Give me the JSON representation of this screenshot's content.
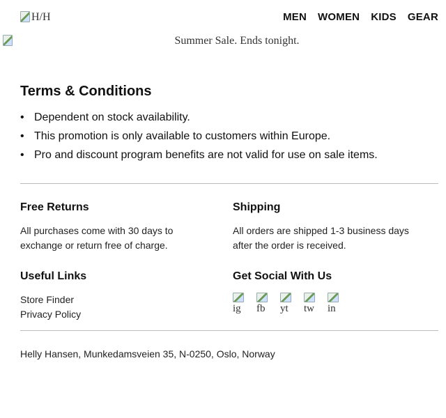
{
  "header": {
    "logo_alt": "H/H",
    "nav": [
      "MEN",
      "WOMEN",
      "KIDS",
      "GEAR"
    ]
  },
  "banner": {
    "text": "Summer Sale. Ends tonight."
  },
  "terms": {
    "title": "Terms & Conditions",
    "items": [
      "Dependent on stock availability.",
      "This promotion is only available to customers within Europe.",
      "Pro and discount program benefits are not valid for use on sale items."
    ]
  },
  "free_returns": {
    "title": "Free Returns",
    "text": "All purchases come with 30 days to exchange or return free of charge."
  },
  "shipping": {
    "title": "Shipping",
    "text": "All orders are shipped 1-3 business days after the order is received."
  },
  "useful_links": {
    "title": "Useful Links",
    "links": [
      "Store Finder",
      "Privacy Policy"
    ]
  },
  "social": {
    "title": "Get Social With Us",
    "items": [
      "ig",
      "fb",
      "yt",
      "tw",
      "in"
    ]
  },
  "footer": {
    "address": "Helly Hansen, Munkedamsveien 35, N-0250, Oslo, Norway"
  }
}
